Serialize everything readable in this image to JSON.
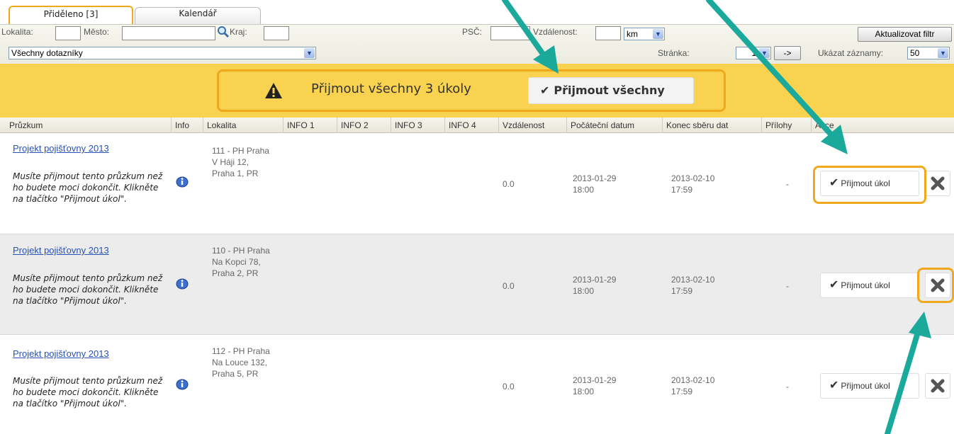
{
  "tabs": [
    {
      "label": "Přiděleno [3]",
      "active": true
    },
    {
      "label": "Kalendář",
      "active": false
    }
  ],
  "filters": {
    "lokalita_label": "Lokalita:",
    "lokalita_value": "",
    "mesto_label": "Město:",
    "mesto_value": "",
    "kraj_label": "Kraj:",
    "kraj_value": "",
    "psc_label": "PSČ:",
    "psc_value": "",
    "vzdalenost_label": "Vzdálenost:",
    "vzdalenost_value": "",
    "unit_selected": "km",
    "update_button": "Aktualizovat filtr",
    "questionnaire_selected": "Všechny dotazníky",
    "page_label": "Stránka:",
    "page_selected": "1",
    "go_button": "->",
    "show_label": "Ukázat záznamy:",
    "show_selected": "50"
  },
  "banner": {
    "text": "Přijmout všechny 3 úkoly",
    "button": "Přijmout všechny"
  },
  "table": {
    "columns": [
      "Průzkum",
      "Info",
      "Lokalita",
      "INFO 1",
      "INFO 2",
      "INFO 3",
      "INFO 4",
      "Vzdálenost",
      "Počáteční datum",
      "Konec sběru dat",
      "Přílohy",
      "Akce"
    ],
    "rows": [
      {
        "project": "Projekt pojišťovny 2013",
        "note": "Musíte přijmout tento průzkum než ho budete moci dokončit. Klikněte na tlačítko \"Přijmout úkol\".",
        "location": "111 - PH Praha\nV Háji 12,\nPraha 1, PR",
        "distance": "0.0",
        "start": "2013-01-29\n18:00",
        "end": "2013-02-10\n17:59",
        "attachments": "-",
        "accept": "Přijmout úkol"
      },
      {
        "project": "Projekt pojišťovny 2013",
        "note": "Musíte přijmout tento průzkum než ho budete moci dokončit. Klikněte na tlačítko \"Přijmout úkol\".",
        "location": "110 - PH Praha\nNa Kopci 78,\nPraha 2, PR",
        "distance": "0.0",
        "start": "2013-01-29\n18:00",
        "end": "2013-02-10\n17:59",
        "attachments": "-",
        "accept": "Přijmout úkol"
      },
      {
        "project": "Projekt pojišťovny 2013",
        "note": "Musíte přijmout tento průzkum než ho budete moci dokončit. Klikněte na tlačítko \"Přijmout úkol\".",
        "location": "112 - PH Praha\nNa Louce 132,\nPraha 5, PR",
        "distance": "0.0",
        "start": "2013-01-29\n18:00",
        "end": "2013-02-10\n17:59",
        "attachments": "-",
        "accept": "Přijmout úkol"
      }
    ]
  },
  "icons": {
    "search": "magnifier-icon",
    "warning": "warning-triangle-icon",
    "check": "checkmark-icon",
    "info": "info-icon",
    "close": "x-icon"
  },
  "colors": {
    "highlight": "#f0a81c",
    "banner": "#f9d24f",
    "arrow": "#1aa99b",
    "link": "#2752b5"
  }
}
